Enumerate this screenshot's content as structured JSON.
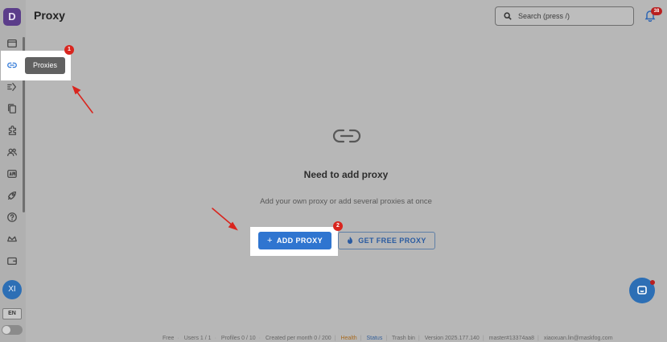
{
  "app": {
    "logo_letter": "D"
  },
  "header": {
    "title": "Proxy",
    "search_placeholder": "Search (press /)",
    "notifications_count": "38"
  },
  "sidebar": {
    "items": [
      {
        "icon": "browser-window-icon"
      },
      {
        "icon": "link-icon",
        "tooltip": "Proxies",
        "active": true
      },
      {
        "icon": "automation-icon"
      },
      {
        "icon": "copy-icon"
      },
      {
        "icon": "extension-puzzle-icon"
      },
      {
        "icon": "users-icon"
      },
      {
        "icon": "api-icon"
      },
      {
        "icon": "rocket-icon"
      },
      {
        "icon": "help-icon"
      },
      {
        "icon": "crown-icon"
      },
      {
        "icon": "wallet-icon"
      }
    ],
    "avatar_initials": "XI",
    "language": "EN"
  },
  "empty_state": {
    "icon": "link-icon",
    "title": "Need to add proxy",
    "description": "Add your own proxy or add several proxies at once",
    "add_button": "ADD PROXY",
    "free_button": "GET FREE PROXY"
  },
  "annotations": {
    "step1": "1",
    "step2": "2",
    "color": "#d9251e"
  },
  "footer": {
    "plan": "Free",
    "users": "Users 1 / 1",
    "profiles": "Profiles 0 / 10",
    "created": "Created per month 0 / 200",
    "health": "Health",
    "status": "Status",
    "trash": "Trash bin",
    "version": "Version 2025.177.140",
    "build": "master#13374aa8",
    "email": "xiaoxuan.lin@maskfog.com"
  },
  "colors": {
    "accent": "#2f75d0",
    "badge": "#b91f1f",
    "overlay": "#b7b7b7"
  }
}
